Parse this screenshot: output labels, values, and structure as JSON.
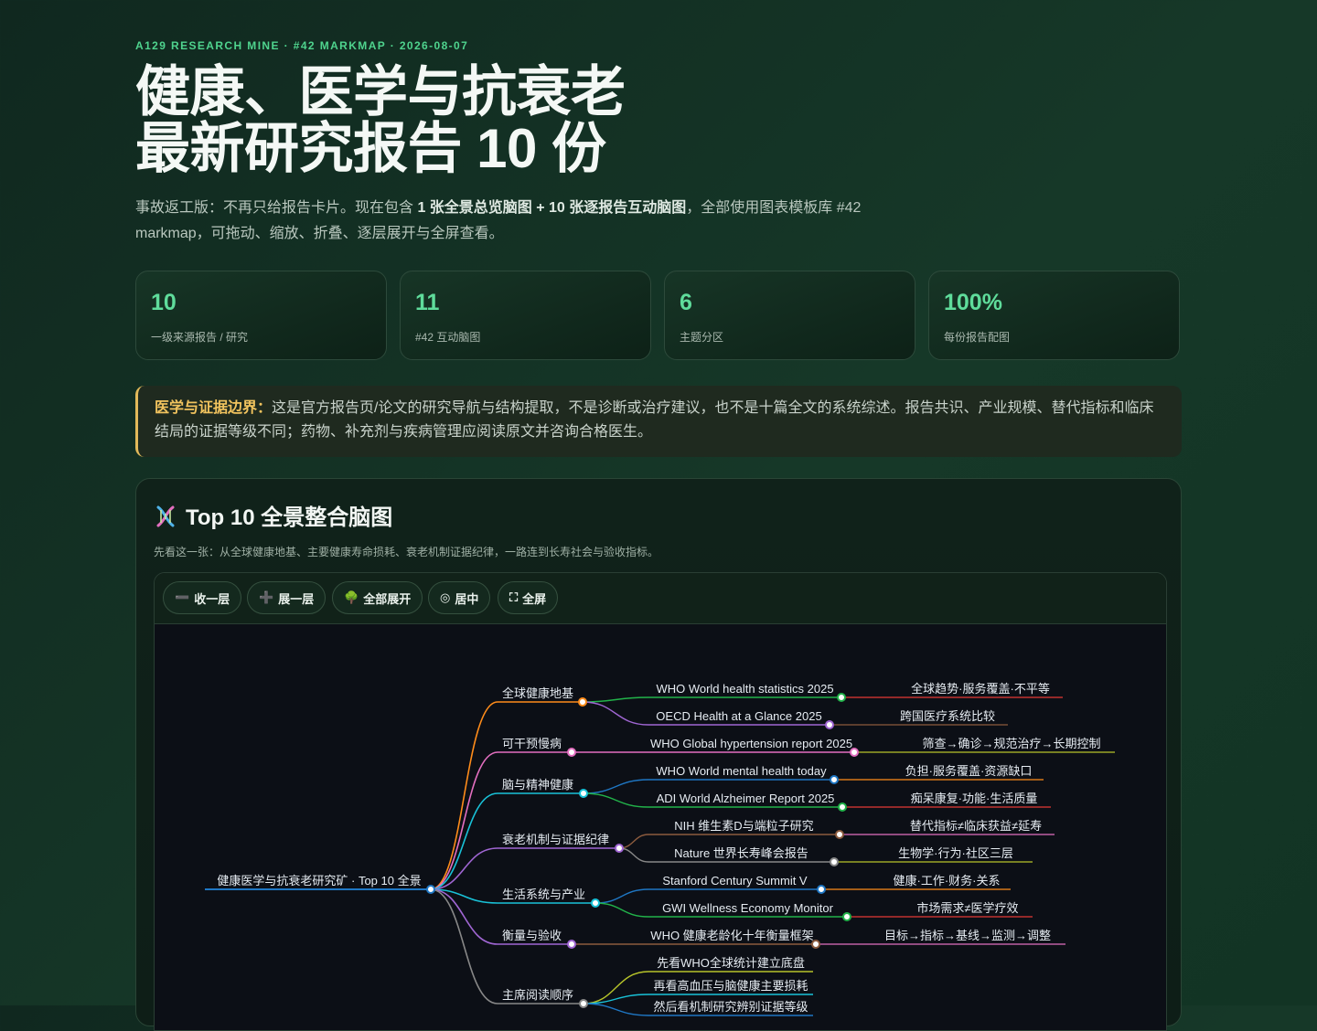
{
  "header": {
    "eyebrow": "A129 RESEARCH MINE · #42 MARKMAP · 2026-08-07",
    "title_line1": "健康、医学与抗衰老",
    "title_line2": "最新研究报告 10 份",
    "intro_pre": "事故返工版：不再只给报告卡片。现在包含 ",
    "intro_bold": "1 张全景总览脑图 + 10 张逐报告互动脑图",
    "intro_post": "，全部使用图表模板库 #42 markmap，可拖动、缩放、折叠、逐层展开与全屏查看。"
  },
  "stats": [
    {
      "value": "10",
      "label": "一级来源报告 / 研究"
    },
    {
      "value": "11",
      "label": "#42 互动脑图"
    },
    {
      "value": "6",
      "label": "主题分区"
    },
    {
      "value": "100%",
      "label": "每份报告配图"
    }
  ],
  "notice": {
    "lead": "医学与证据边界：",
    "text": "这是官方报告页/论文的研究导航与结构提取，不是诊断或治疗建议，也不是十篇全文的系统综述。报告共识、产业规模、替代指标和临床结局的证据等级不同；药物、补充剂与疾病管理应阅读原文并咨询合格医生。"
  },
  "panel": {
    "title": "Top 10 全景整合脑图",
    "description": "先看这一张：从全球健康地基、主要健康寿命损耗、衰老机制证据纪律，一路连到长寿社会与验收指标。",
    "icon": "dna-icon"
  },
  "toolbar": {
    "collapse": {
      "icon": "➖",
      "label": "收一层"
    },
    "expand": {
      "icon": "➕",
      "label": "展一层"
    },
    "expand_all": {
      "icon": "🌳",
      "label": "全部展开"
    },
    "center": {
      "icon": "◎",
      "label": "居中"
    },
    "fullscreen": {
      "icon": "⛶",
      "label": "全屏"
    }
  },
  "mindmap": {
    "root": "健康医学与抗衰老研究矿 · Top 10 全景",
    "branches": [
      {
        "label": "全球健康地基",
        "color": "#ff8c1a",
        "children": [
          {
            "label": "WHO World health statistics 2025",
            "color": "#22b34a",
            "leaf": "全球趋势·服务覆盖·不平等",
            "leaf_color": "#e53935"
          },
          {
            "label": "OECD Health at a Glance 2025",
            "color": "#a066d3",
            "leaf": "跨国医疗系统比较",
            "leaf_color": "#8c5b3e"
          }
        ]
      },
      {
        "label": "可干预慢病",
        "color": "#e36fc0",
        "children": [
          {
            "label": "WHO Global hypertension report 2025",
            "color": "#e36fc0",
            "leaf": "筛查→确诊→规范治疗→长期控制",
            "leaf_color": "#b7c42a"
          }
        ]
      },
      {
        "label": "脑与精神健康",
        "color": "#19c2d8",
        "children": [
          {
            "label": "WHO World mental health today",
            "color": "#1f77c4",
            "leaf": "负担·服务覆盖·资源缺口",
            "leaf_color": "#ff8c1a"
          },
          {
            "label": "ADI World Alzheimer Report 2025",
            "color": "#22b34a",
            "leaf": "痴呆康复·功能·生活质量",
            "leaf_color": "#e53935"
          }
        ]
      },
      {
        "label": "衰老机制与证据纪律",
        "color": "#a066d3",
        "children": [
          {
            "label": "NIH 维生素D与端粒子研究",
            "color": "#8c5b3e",
            "leaf": "替代指标≠临床获益≠延寿",
            "leaf_color": "#e36fc0"
          },
          {
            "label": "Nature 世界长寿峰会报告",
            "color": "#888888",
            "leaf": "生物学·行为·社区三层",
            "leaf_color": "#b7c42a"
          }
        ]
      },
      {
        "label": "生活系统与产业",
        "color": "#19c2d8",
        "children": [
          {
            "label": "Stanford Century Summit V",
            "color": "#1f77c4",
            "leaf": "健康·工作·财务·关系",
            "leaf_color": "#ff8c1a"
          },
          {
            "label": "GWI Wellness Economy Monitor",
            "color": "#22b34a",
            "leaf": "市场需求≠医学疗效",
            "leaf_color": "#e53935"
          }
        ]
      },
      {
        "label": "衡量与验收",
        "color": "#a066d3",
        "children": [
          {
            "label": "WHO 健康老龄化十年衡量框架",
            "color": "#8c5b3e",
            "leaf": "目标→指标→基线→监测→调整",
            "leaf_color": "#e36fc0"
          }
        ]
      },
      {
        "label": "主席阅读顺序",
        "color": "#888888",
        "children": [
          {
            "label": "先看WHO全球统计建立底盘",
            "color": "#b7c42a"
          },
          {
            "label": "再看高血压与脑健康主要损耗",
            "color": "#19c2d8"
          },
          {
            "label": "然后看机制研究辨别证据等级",
            "color": "#1f77c4"
          }
        ]
      }
    ]
  }
}
